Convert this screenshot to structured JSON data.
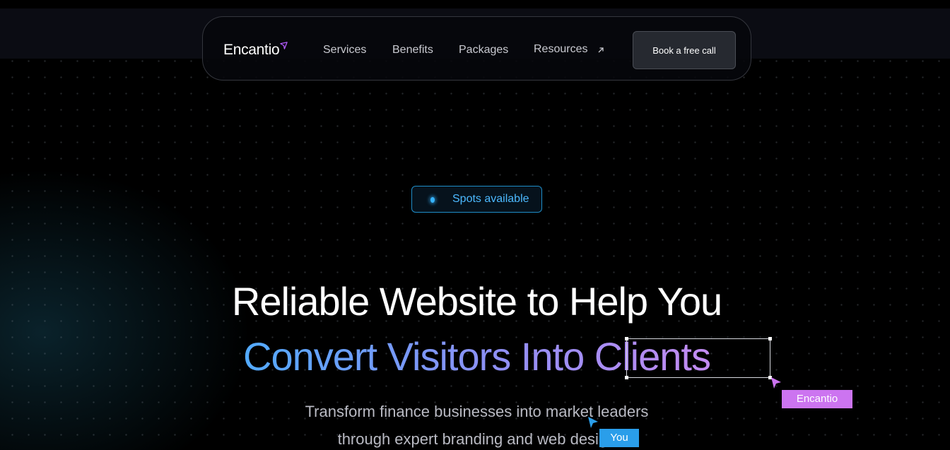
{
  "nav": {
    "logo": "Encantio",
    "links": [
      "Services",
      "Benefits",
      "Packages",
      "Resources"
    ],
    "cta": "Book a free call"
  },
  "hero": {
    "badge": "Spots available",
    "headline_line1": "Reliable Website to Help You",
    "headline_line2": "Convert Visitors Into Clients",
    "subtitle_line1": "Transform finance businesses into market leaders",
    "subtitle_line2": "through expert branding and web design"
  },
  "cursors": {
    "encantio_label": "Encantio",
    "you_label": "You"
  },
  "colors": {
    "background": "#000000",
    "badge_accent": "#36b4ff",
    "gradient_start": "#52aaff",
    "gradient_end": "#c38bf2",
    "encantio_tag": "#cc74f0",
    "you_tag": "#2a9eea"
  }
}
